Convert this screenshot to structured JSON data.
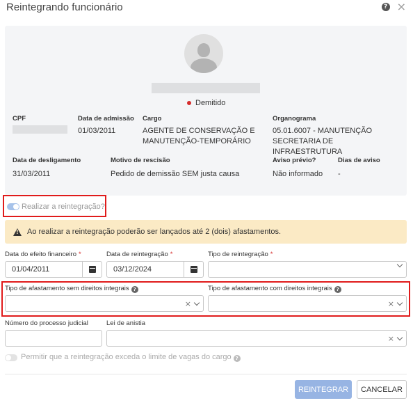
{
  "dialog": {
    "title": "Reintegrando funcionário"
  },
  "employee": {
    "status": "Demitido",
    "fields_row1": [
      {
        "label": "CPF",
        "value": ""
      },
      {
        "label": "Data de admissão",
        "value": "01/03/2011"
      },
      {
        "label": "Cargo",
        "value": "AGENTE DE CONSERVAÇÃO E MANUTENÇÃO-TEMPORÁRIO"
      },
      {
        "label": "Organograma",
        "value": "05.01.6007 - MANUTENÇÃO SECRETARIA DE INFRAESTRUTURA"
      }
    ],
    "fields_row2": [
      {
        "label": "Data de desligamento",
        "value": "31/03/2011"
      },
      {
        "label": "Motivo de rescisão",
        "value": "Pedido de demissão SEM justa causa"
      },
      {
        "label": "Aviso prévio?",
        "value": "Não informado"
      },
      {
        "label": "Dias de aviso",
        "value": "-"
      }
    ]
  },
  "reintegration_toggle": {
    "label": "Realizar a reintegração?",
    "on": true
  },
  "alert": {
    "text": "Ao realizar a reintegração poderão ser lançados até 2 (dois) afastamentos."
  },
  "form": {
    "financial_date": {
      "label": "Data do efeito financeiro",
      "required": "*",
      "value": "01/04/2011"
    },
    "reint_date": {
      "label": "Data de reintegração",
      "required": "*",
      "value": "03/12/2024"
    },
    "reint_type": {
      "label": "Tipo de reintegração",
      "required": "*",
      "value": ""
    },
    "leave_without": {
      "label": "Tipo de afastamento sem direitos integrais",
      "value": ""
    },
    "leave_with": {
      "label": "Tipo de afastamento com direitos integrais",
      "value": ""
    },
    "process_number": {
      "label": "Número do processo judicial",
      "value": ""
    },
    "amnesty_law": {
      "label": "Lei de anistia",
      "value": ""
    }
  },
  "permit_toggle": {
    "label": "Permitir que a reintegração exceda o limite de vagas do cargo",
    "on": false
  },
  "buttons": {
    "submit": "REINTEGRAR",
    "cancel": "CANCELAR"
  },
  "colors": {
    "primary_disabled": "#97b4e3",
    "highlight": "#e01b1b",
    "alert_bg": "#fbeac5",
    "status_dot": "#d62c2c"
  }
}
